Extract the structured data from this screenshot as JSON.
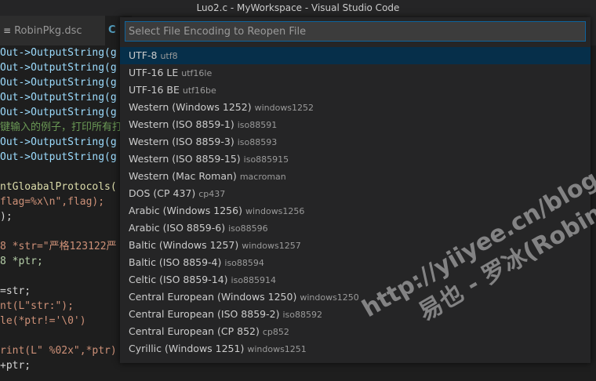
{
  "window": {
    "title": "Luo2.c - MyWorkspace - Visual Studio Code"
  },
  "tabs": [
    {
      "label": "RobinPkg.dsc",
      "icon": "menu-lines-icon"
    },
    {
      "label": "C",
      "icon": "c-file-icon"
    }
  ],
  "palette": {
    "placeholder": "Select File Encoding to Reopen File",
    "items": [
      {
        "label": "UTF-8",
        "desc": "utf8"
      },
      {
        "label": "UTF-16 LE",
        "desc": "utf16le"
      },
      {
        "label": "UTF-16 BE",
        "desc": "utf16be"
      },
      {
        "label": "Western (Windows 1252)",
        "desc": "windows1252"
      },
      {
        "label": "Western (ISO 8859-1)",
        "desc": "iso88591"
      },
      {
        "label": "Western (ISO 8859-3)",
        "desc": "iso88593"
      },
      {
        "label": "Western (ISO 8859-15)",
        "desc": "iso885915"
      },
      {
        "label": "Western (Mac Roman)",
        "desc": "macroman"
      },
      {
        "label": "DOS (CP 437)",
        "desc": "cp437"
      },
      {
        "label": "Arabic (Windows 1256)",
        "desc": "windows1256"
      },
      {
        "label": "Arabic (ISO 8859-6)",
        "desc": "iso88596"
      },
      {
        "label": "Baltic (Windows 1257)",
        "desc": "windows1257"
      },
      {
        "label": "Baltic (ISO 8859-4)",
        "desc": "iso88594"
      },
      {
        "label": "Celtic (ISO 8859-14)",
        "desc": "iso885914"
      },
      {
        "label": "Central European (Windows 1250)",
        "desc": "windows1250"
      },
      {
        "label": "Central European (ISO 8859-2)",
        "desc": "iso88592"
      },
      {
        "label": "Central European (CP 852)",
        "desc": "cp852"
      },
      {
        "label": "Cyrillic (Windows 1251)",
        "desc": "windows1251"
      }
    ]
  },
  "code_lines": [
    {
      "text": "Out->OutputString(g",
      "color": "#9cdcfe"
    },
    {
      "text": "Out->OutputString(g",
      "color": "#9cdcfe"
    },
    {
      "text": "Out->OutputString(g",
      "color": "#9cdcfe"
    },
    {
      "text": "Out->OutputString(g",
      "color": "#9cdcfe"
    },
    {
      "text": "Out->OutputString(g",
      "color": "#9cdcfe"
    },
    {
      "text": "键输入的例子，打印所有打",
      "color": "#6a9955"
    },
    {
      "text": "Out->OutputString(g",
      "color": "#9cdcfe"
    },
    {
      "text": "Out->OutputString(g",
      "color": "#9cdcfe"
    },
    {
      "text": "",
      "color": "#d4d4d4"
    },
    {
      "text": "ntGloabalProtocols(",
      "color": "#dcdcaa"
    },
    {
      "text": "flag=%x\\n\",flag);",
      "color": "#ce9178"
    },
    {
      "text": ");",
      "color": "#d4d4d4"
    },
    {
      "text": "",
      "color": "#d4d4d4"
    },
    {
      "text": "8 *str=\"严格123122严",
      "color": "#ce9178"
    },
    {
      "text": "8 *ptr;",
      "color": "#b5cea8"
    },
    {
      "text": "",
      "color": "#d4d4d4"
    },
    {
      "text": "=str;",
      "color": "#d4d4d4"
    },
    {
      "text": "nt(L\"str:\");",
      "color": "#ce9178"
    },
    {
      "text": "le(*ptr!='\\0')",
      "color": "#ce9178"
    },
    {
      "text": "",
      "color": "#d4d4d4"
    },
    {
      "text": "rint(L\" %02x\",*ptr)",
      "color": "#ce9178"
    },
    {
      "text": "+ptr;",
      "color": "#d4d4d4"
    }
  ],
  "watermark": {
    "line1": "http://yiiyee.cn/blog/",
    "line2": "易也 - 罗冰(Robin)"
  },
  "colors": {
    "selection": "#062f4a",
    "focus_border": "#0e639c"
  }
}
